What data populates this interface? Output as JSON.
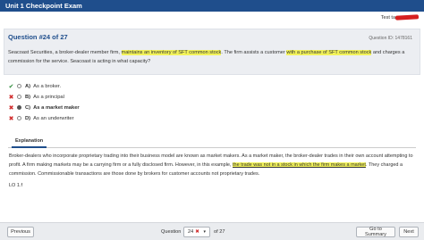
{
  "window": {
    "title": "Unit 1 Checkpoint Exam"
  },
  "user": {
    "label": "Test ta"
  },
  "question": {
    "header": "Question #24 of 27",
    "id": "Question ID: 1478161",
    "text_parts": [
      {
        "text": "Seacoast Securities, a broker-dealer member firm, ",
        "highlight": false
      },
      {
        "text": "maintains an inventory of SFT common stock",
        "highlight": true
      },
      {
        "text": ". The firm assists a customer ",
        "highlight": false
      },
      {
        "text": "with a purchase of SFT common stock",
        "highlight": true
      },
      {
        "text": " and charges a commission for the service. Seacoast is acting in what capacity?",
        "highlight": false
      }
    ]
  },
  "choices": [
    {
      "mark": "✔",
      "status": "correct",
      "letter": "A)",
      "label": "As a broker.",
      "selected": false,
      "bold": false
    },
    {
      "mark": "✖",
      "status": "wrong",
      "letter": "B)",
      "label": "As a principal",
      "selected": false,
      "bold": false
    },
    {
      "mark": "✖",
      "status": "wrong",
      "letter": "C)",
      "label": "As a market maker",
      "selected": true,
      "bold": true
    },
    {
      "mark": "✖",
      "status": "wrong",
      "letter": "D)",
      "label": "As an underwriter",
      "selected": false,
      "bold": false
    }
  ],
  "tabs": {
    "explanation": "Explanation"
  },
  "explanation": {
    "parts": [
      {
        "text": "Broker-dealers who incorporate proprietary trading into their business model are known as market makers. As a market maker, the broker-dealer trades in their own account attempting to profit. A firm making markets may be a carrying firm or a fully disclosed firm. However, in this example, ",
        "highlight": false
      },
      {
        "text": "the trade was not in a stock in which the firm makes a market",
        "highlight": true
      },
      {
        "text": ". They charged a commission. Commissionable transactions are those done by brokers for customer accounts not proprietary trades.",
        "highlight": false
      }
    ],
    "lo": "LO 1.f"
  },
  "footer": {
    "previous": "Previous",
    "question_label": "Question",
    "current": "24",
    "current_mark": "✖",
    "of_total": "of 27",
    "summary": "Go to Summary",
    "next": "Next"
  },
  "colors": {
    "titlebar": "#1f4e8c",
    "highlight": "#f3f35a",
    "correct": "#2e8b3a",
    "wrong": "#d02a2a"
  }
}
